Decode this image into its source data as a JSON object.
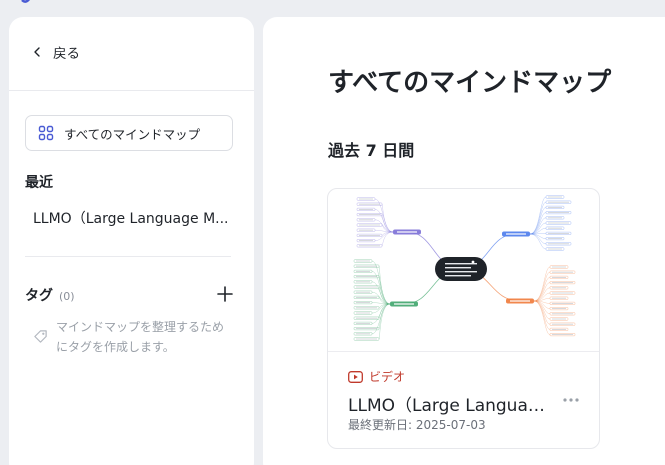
{
  "sidebar": {
    "back_label": "戻る",
    "all_button_label": "すべてのマインドマップ",
    "recent_heading": "最近",
    "recent_items": [
      {
        "label": "LLMO（Large Language M..."
      }
    ],
    "tags_heading": "タグ",
    "tags_count": "(0)",
    "tags_empty_text": "マインドマップを整理するためにタグを作成します。"
  },
  "main": {
    "title": "すべてのマインドマップ",
    "section_heading": "過去 7 日間",
    "cards": [
      {
        "type_label": "ビデオ",
        "title": "LLMO（Large Language ...",
        "updated": "最終更新日: 2025-07-03"
      }
    ]
  },
  "colors": {
    "background": "#eceef2",
    "panel": "#ffffff",
    "accent_icon": "#4a5bd4",
    "video_red": "#c0392b",
    "branch_purple": "#7b6fd6",
    "branch_blue": "#4b7bec",
    "branch_green": "#3fa56b",
    "branch_orange": "#f07a3a"
  },
  "icons": {
    "back": "chevron-left-icon",
    "all": "grid-icon",
    "add": "plus-icon",
    "tag": "tag-icon",
    "video": "video-play-icon",
    "more": "more-horizontal-icon"
  }
}
